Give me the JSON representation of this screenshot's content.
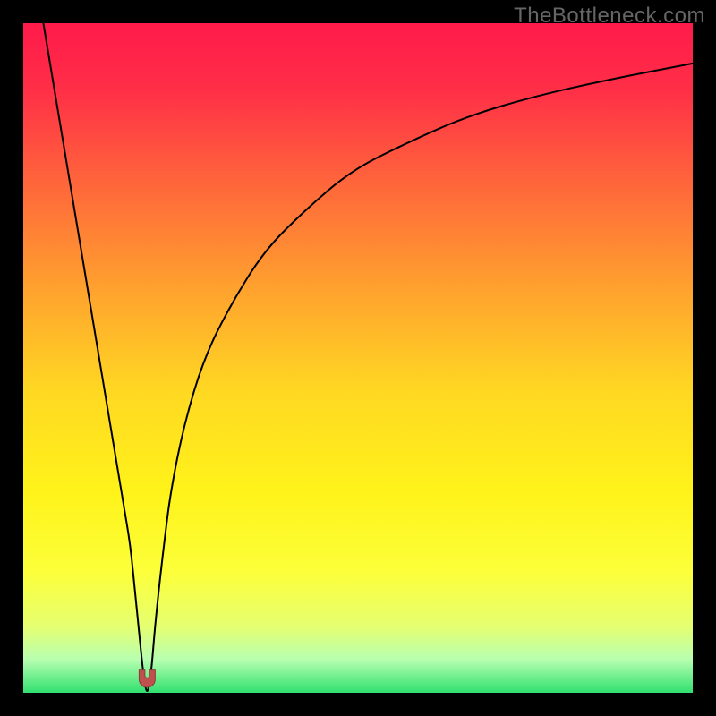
{
  "watermark": "TheBottleneck.com",
  "chart_data": {
    "type": "line",
    "title": "",
    "xlabel": "",
    "ylabel": "",
    "xlim": [
      0,
      100
    ],
    "ylim": [
      0,
      100
    ],
    "background_gradient": {
      "stops": [
        {
          "offset": 0.0,
          "color": "#ff1a4a"
        },
        {
          "offset": 0.1,
          "color": "#ff2f47"
        },
        {
          "offset": 0.25,
          "color": "#ff6a3a"
        },
        {
          "offset": 0.4,
          "color": "#ffa32e"
        },
        {
          "offset": 0.55,
          "color": "#ffd822"
        },
        {
          "offset": 0.7,
          "color": "#fff31a"
        },
        {
          "offset": 0.82,
          "color": "#fcff3a"
        },
        {
          "offset": 0.9,
          "color": "#e6ff70"
        },
        {
          "offset": 0.95,
          "color": "#b8ffb0"
        },
        {
          "offset": 1.0,
          "color": "#30e070"
        }
      ]
    },
    "series": [
      {
        "name": "bottleneck-curve",
        "stroke": "#000000",
        "stroke_width": 2,
        "x": [
          3,
          4,
          5,
          6,
          7,
          8,
          9,
          10,
          11,
          12,
          13,
          14,
          15,
          16,
          16.7,
          17.3,
          17.8,
          18.2,
          18.5,
          18.8,
          19.2,
          19.6,
          20.2,
          21,
          22,
          24,
          27,
          31,
          36,
          42,
          49,
          57,
          66,
          76,
          87,
          100
        ],
        "y": [
          100,
          94,
          88,
          82,
          76,
          70,
          64,
          58,
          52,
          46,
          40,
          34,
          28,
          22,
          15,
          9,
          4,
          1,
          0,
          1,
          4,
          9,
          15,
          22,
          30,
          40,
          50,
          58,
          66,
          72,
          78,
          82,
          86,
          89,
          91.5,
          94
        ]
      }
    ],
    "markers": [
      {
        "name": "min-marker",
        "shape": "rounded-u",
        "x": 18.5,
        "y": 0.8,
        "width": 2.4,
        "height": 2.6,
        "fill": "#c0504d",
        "stroke": "#8b3b39"
      }
    ]
  }
}
